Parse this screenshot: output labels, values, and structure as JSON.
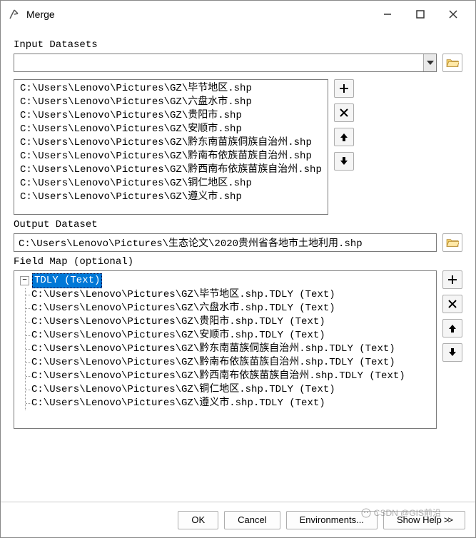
{
  "titlebar": {
    "title": "Merge"
  },
  "labels": {
    "input": "Input Datasets",
    "output": "Output Dataset",
    "fieldmap": "Field Map (optional)"
  },
  "inputDatasets": [
    "C:\\Users\\Lenovo\\Pictures\\GZ\\毕节地区.shp",
    "C:\\Users\\Lenovo\\Pictures\\GZ\\六盘水市.shp",
    "C:\\Users\\Lenovo\\Pictures\\GZ\\贵阳市.shp",
    "C:\\Users\\Lenovo\\Pictures\\GZ\\安顺市.shp",
    "C:\\Users\\Lenovo\\Pictures\\GZ\\黔东南苗族侗族自治州.shp",
    "C:\\Users\\Lenovo\\Pictures\\GZ\\黔南布依族苗族自治州.shp",
    "C:\\Users\\Lenovo\\Pictures\\GZ\\黔西南布依族苗族自治州.shp",
    "C:\\Users\\Lenovo\\Pictures\\GZ\\铜仁地区.shp",
    "C:\\Users\\Lenovo\\Pictures\\GZ\\遵义市.shp"
  ],
  "outputDataset": "C:\\Users\\Lenovo\\Pictures\\生态论文\\2020贵州省各地市土地利用.shp",
  "fieldMap": {
    "root": "TDLY (Text)",
    "children": [
      "C:\\Users\\Lenovo\\Pictures\\GZ\\毕节地区.shp.TDLY (Text)",
      "C:\\Users\\Lenovo\\Pictures\\GZ\\六盘水市.shp.TDLY (Text)",
      "C:\\Users\\Lenovo\\Pictures\\GZ\\贵阳市.shp.TDLY (Text)",
      "C:\\Users\\Lenovo\\Pictures\\GZ\\安顺市.shp.TDLY (Text)",
      "C:\\Users\\Lenovo\\Pictures\\GZ\\黔东南苗族侗族自治州.shp.TDLY (Text)",
      "C:\\Users\\Lenovo\\Pictures\\GZ\\黔南布依族苗族自治州.shp.TDLY (Text)",
      "C:\\Users\\Lenovo\\Pictures\\GZ\\黔西南布依族苗族自治州.shp.TDLY (Text)",
      "C:\\Users\\Lenovo\\Pictures\\GZ\\铜仁地区.shp.TDLY (Text)",
      "C:\\Users\\Lenovo\\Pictures\\GZ\\遵义市.shp.TDLY (Text)"
    ]
  },
  "buttons": {
    "ok": "OK",
    "cancel": "Cancel",
    "environments": "Environments...",
    "showHelp": "Show Help"
  },
  "watermark": "CSDN @GIS前沿"
}
